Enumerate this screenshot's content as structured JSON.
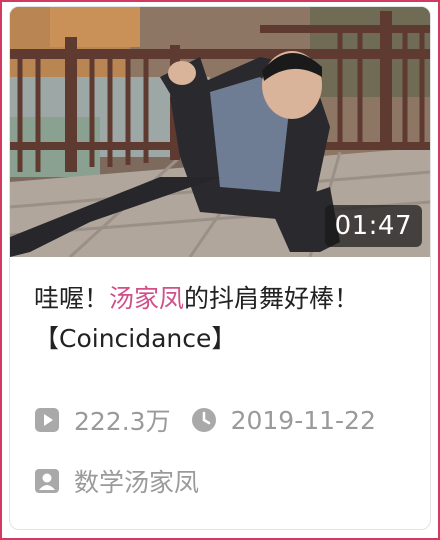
{
  "video": {
    "duration": "01:47",
    "title_parts": [
      "哇喔！",
      "汤家凤",
      "的抖肩舞好棒！【Coincidance】"
    ],
    "views": "222.3万",
    "date": "2019-11-22",
    "author": "数学汤家凤"
  },
  "icons": {
    "views": "play-icon",
    "date": "clock-icon",
    "author": "user-icon"
  },
  "colors": {
    "border_accent": "#d23a62",
    "title_highlight": "#d0508a",
    "meta_text": "#9a9a9a",
    "title_text": "#222222"
  }
}
